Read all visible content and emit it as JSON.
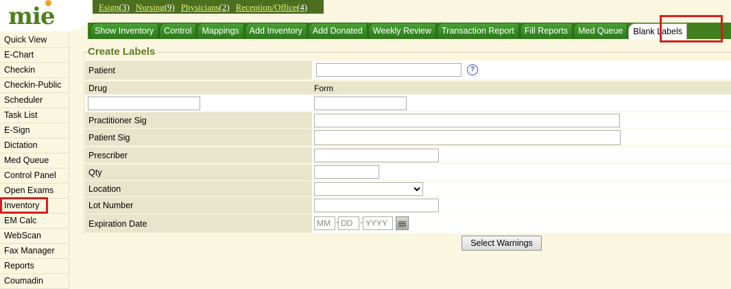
{
  "brand": {
    "logo_text": "mie"
  },
  "quicklinks": [
    {
      "label": "Esign",
      "count": "(3)"
    },
    {
      "label": "Nursing",
      "count": "(9)"
    },
    {
      "label": "Physicians",
      "count": "(2)"
    },
    {
      "label": "Reception/Office",
      "count": "(4)"
    }
  ],
  "tabs": [
    {
      "label": "Show Inventory"
    },
    {
      "label": "Control"
    },
    {
      "label": "Mappings"
    },
    {
      "label": "Add Inventory"
    },
    {
      "label": "Add Donated"
    },
    {
      "label": "Weekly Review"
    },
    {
      "label": "Transaction Report"
    },
    {
      "label": "Fill Reports"
    },
    {
      "label": "Med Queue"
    },
    {
      "label": "Blank Labels",
      "active": true
    }
  ],
  "sidebar": {
    "items": [
      {
        "label": "Quick View"
      },
      {
        "label": "E-Chart"
      },
      {
        "label": "Checkin"
      },
      {
        "label": "Checkin-Public"
      },
      {
        "label": "Scheduler"
      },
      {
        "label": "Task List"
      },
      {
        "label": "E-Sign"
      },
      {
        "label": "Dictation"
      },
      {
        "label": "Med Queue"
      },
      {
        "label": "Control Panel"
      },
      {
        "label": "Open Exams"
      },
      {
        "label": "Inventory",
        "highlighted": true
      },
      {
        "label": "EM Calc"
      },
      {
        "label": "WebScan"
      },
      {
        "label": "Fax Manager"
      },
      {
        "label": "Reports"
      },
      {
        "label": "Coumadin"
      }
    ]
  },
  "form": {
    "legend": "Create Labels",
    "patient_label": "Patient",
    "help_icon": "?",
    "drug_label": "Drug",
    "form_label": "Form",
    "practitioner_sig_label": "Practitioner Sig",
    "patient_sig_label": "Patient Sig",
    "prescriber_label": "Prescriber",
    "qty_label": "Qty",
    "location_label": "Location",
    "lot_number_label": "Lot Number",
    "expiration_label": "Expiration Date",
    "exp_mm_placeholder": "MM",
    "exp_dd_placeholder": "DD",
    "exp_yyyy_placeholder": "YYYY",
    "date_separator": "-",
    "select_warnings_button": "Select Warnings"
  },
  "colors": {
    "header_green": "#4c6e1f",
    "tab_green": "#3f7f1c",
    "legend_green": "#5b7c22",
    "page_bg": "#fbf6e0",
    "label_cell_bg": "#e9e4cc",
    "highlight_red": "#d61c1c"
  }
}
